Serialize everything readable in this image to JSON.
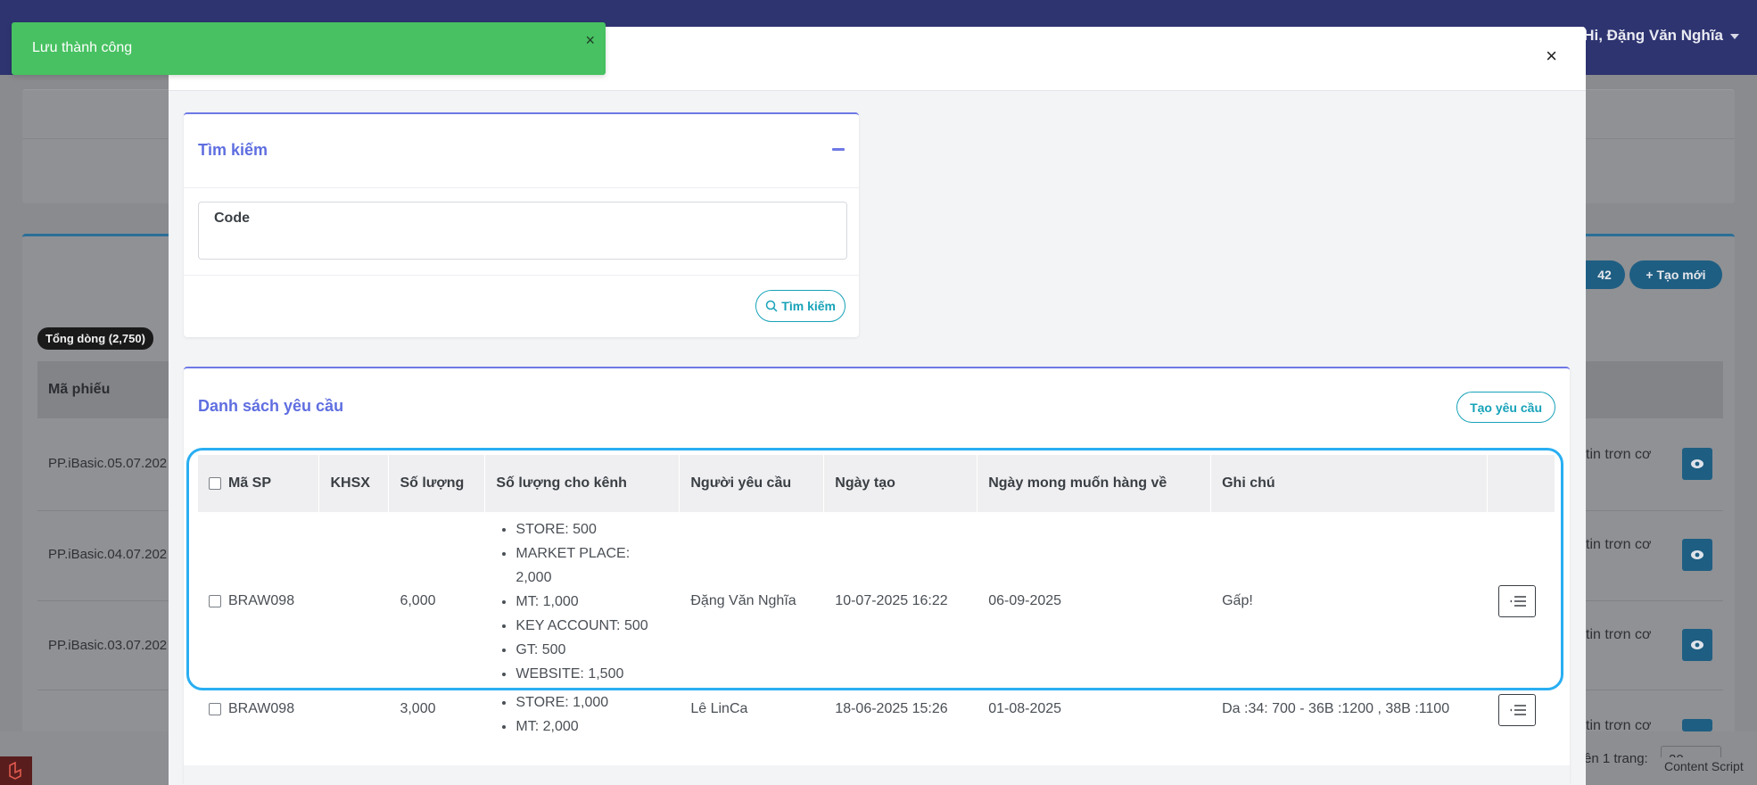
{
  "background": {
    "user_greeting": "Hi, Đặng Văn Nghĩa",
    "total_badge": "Tổng dòng (2,750)",
    "table_header": "Mã phiếu",
    "rows": [
      {
        "code": "PP.iBasic.05.07.202",
        "right_text": "tin trơn cơ"
      },
      {
        "code": "PP.iBasic.04.07.202",
        "right_text": "tin trơn cơ"
      },
      {
        "code": "PP.iBasic.03.07.202",
        "right_text": "tin trơn cơ"
      }
    ],
    "row4_right_text": "tin trơn cơ",
    "count_pill": "42",
    "create_new_label": "+ Tạo mới",
    "footer_text": "ên 1 trang:",
    "page_size": "20",
    "content_script": "Content Script"
  },
  "toast": {
    "message": "Lưu thành công",
    "close": "×"
  },
  "modal": {
    "close": "×",
    "search": {
      "title": "Tìm kiếm",
      "code_label": "Code",
      "code_value": "",
      "button_label": "Tìm kiếm"
    },
    "list": {
      "title": "Danh sách yêu cầu",
      "create_button": "Tạo yêu cầu",
      "columns": [
        "Mã SP",
        "KHSX",
        "Số lượng",
        "Số lượng cho kênh",
        "Người yêu cầu",
        "Ngày tạo",
        "Ngày mong muốn hàng về",
        "Ghi chú"
      ],
      "rows": [
        {
          "sku": "BRAW098",
          "khsx": "",
          "quantity": "6,000",
          "channels": [
            "STORE: 500",
            "MARKET PLACE: 2,000",
            "MT: 1,000",
            "KEY ACCOUNT: 500",
            "GT: 500",
            "WEBSITE: 1,500"
          ],
          "requester": "Đặng Văn Nghĩa",
          "created": "10-07-2025 16:22",
          "expected": "06-09-2025",
          "note": "Gấp!"
        },
        {
          "sku": "BRAW098",
          "khsx": "",
          "quantity": "3,000",
          "channels": [
            "STORE: 1,000",
            "MT: 2,000"
          ],
          "requester": "Lê LinCa",
          "created": "18-06-2025 15:26",
          "expected": "01-08-2025",
          "note": "Da :34: 700 - 36B :1200 , 38B :1100"
        }
      ]
    }
  },
  "colors": {
    "accent": "#5f6ee0",
    "info": "#17a2b8",
    "success": "#47c161",
    "highlight": "#29aef2"
  }
}
